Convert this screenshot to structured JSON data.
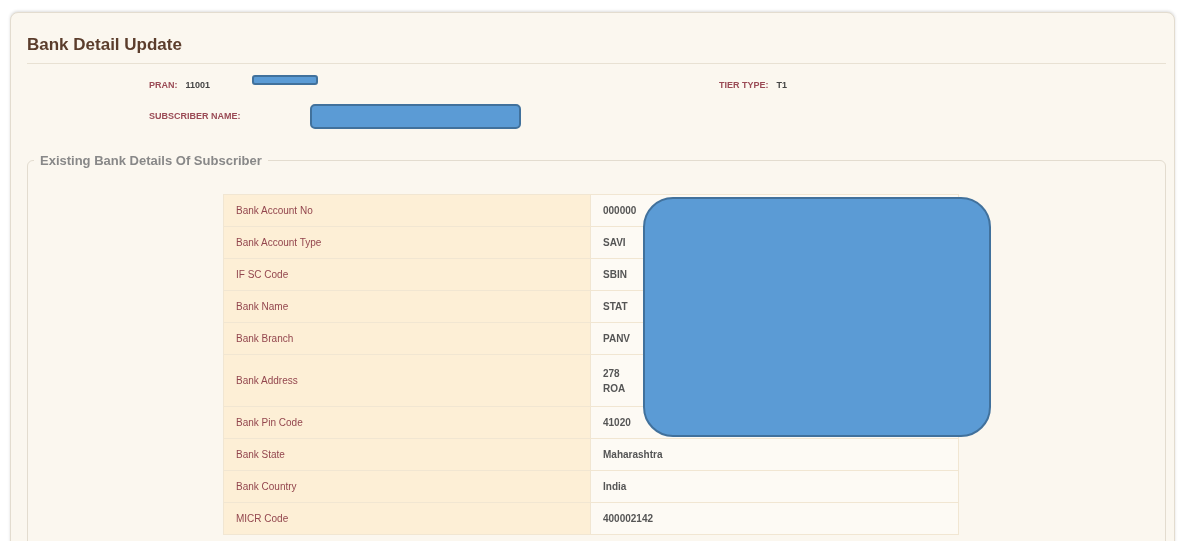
{
  "page": {
    "title": "Bank Detail Update"
  },
  "subscriber": {
    "pran_label": "PRAN:",
    "pran_value": "11001",
    "tier_label": "TIER TYPE:",
    "tier_value": "T1",
    "name_label": "SUBSCRIBER NAME:"
  },
  "section": {
    "legend": "Existing Bank Details Of Subscriber"
  },
  "table": {
    "rows": [
      {
        "label": "Bank Account No",
        "value": [
          "000000"
        ]
      },
      {
        "label": "Bank Account Type",
        "value": [
          "SAVI"
        ]
      },
      {
        "label": "IF SC Code",
        "value": [
          "SBIN"
        ]
      },
      {
        "label": "Bank Name",
        "value": [
          "STAT"
        ]
      },
      {
        "label": "Bank Branch",
        "value": [
          "PANV"
        ]
      },
      {
        "label": "Bank Address",
        "value": [
          "278",
          "ROA"
        ]
      },
      {
        "label": "Bank Pin Code",
        "value": [
          "41020"
        ]
      },
      {
        "label": "Bank State",
        "value": [
          "Maharashtra"
        ]
      },
      {
        "label": "Bank Country",
        "value": [
          "India"
        ]
      },
      {
        "label": "MICR Code",
        "value": [
          "400002142"
        ]
      }
    ]
  }
}
